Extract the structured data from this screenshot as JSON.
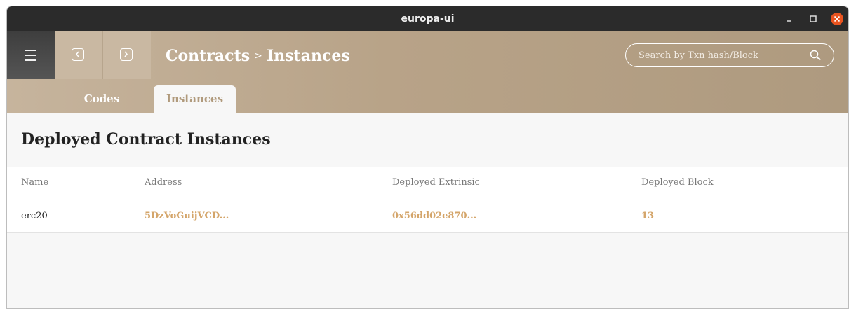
{
  "window": {
    "title": "europa-ui"
  },
  "header": {
    "breadcrumb": [
      "Contracts",
      ">",
      "Instances"
    ],
    "search": {
      "placeholder": "Search by Txn hash/Block",
      "value": ""
    }
  },
  "tabs": [
    {
      "label": "Codes",
      "active": false
    },
    {
      "label": "Instances",
      "active": true
    }
  ],
  "main": {
    "title": "Deployed Contract Instances",
    "table": {
      "columns": [
        "Name",
        "Address",
        "Deployed Extrinsic",
        "Deployed Block"
      ],
      "rows": [
        {
          "name": "erc20",
          "address": "5DzVoGuijVCD...",
          "extrinsic": "0x56dd02e870...",
          "block": "13"
        }
      ]
    }
  },
  "colors": {
    "accent": "#b09a7c",
    "link": "#d4a56a",
    "close": "#e95420",
    "titlebar": "#2b2b2b"
  },
  "icons": [
    "menu-icon",
    "chevron-left-icon",
    "chevron-right-icon",
    "search-icon",
    "minimize-icon",
    "maximize-icon",
    "close-icon"
  ]
}
